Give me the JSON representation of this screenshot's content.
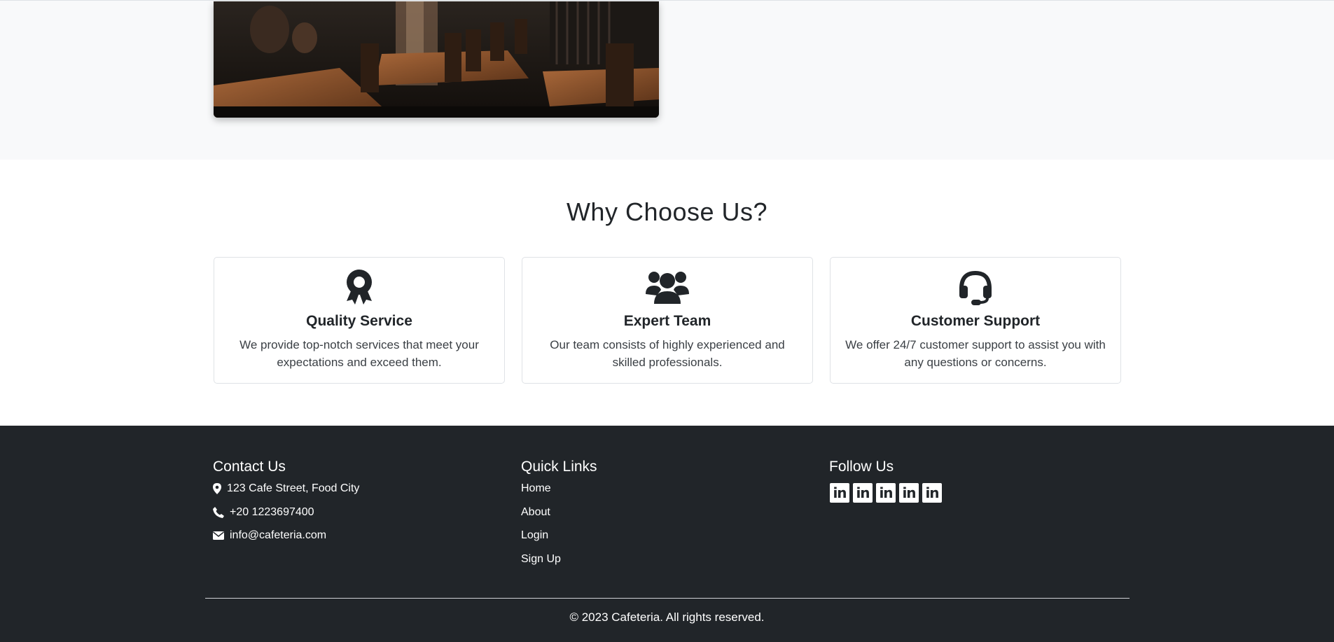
{
  "why_section": {
    "title": "Why Choose Us?",
    "features": [
      {
        "icon": "award-icon",
        "title": "Quality Service",
        "text": "We provide top-notch services that meet your expectations and exceed them."
      },
      {
        "icon": "users-icon",
        "title": "Expert Team",
        "text": "Our team consists of highly experienced and skilled professionals."
      },
      {
        "icon": "headset-icon",
        "title": "Customer Support",
        "text": "We offer 24/7 customer support to assist you with any questions or concerns."
      }
    ]
  },
  "footer": {
    "contact": {
      "heading": "Contact Us",
      "address": "123 Cafe Street, Food City",
      "phone": "+20 1223697400",
      "email": "info@cafeteria.com"
    },
    "quick_links": {
      "heading": "Quick Links",
      "items": [
        "Home",
        "About",
        "Login",
        "Sign Up"
      ]
    },
    "follow": {
      "heading": "Follow Us",
      "icons": [
        "linkedin-icon",
        "linkedin-icon",
        "linkedin-icon",
        "linkedin-icon",
        "linkedin-icon"
      ],
      "icon_text": "in"
    },
    "copyright": "© 2023 Cafeteria. All rights reserved."
  },
  "colors": {
    "footer_bg": "#212529",
    "section_bg": "#f8f9fa",
    "text": "#212529"
  }
}
